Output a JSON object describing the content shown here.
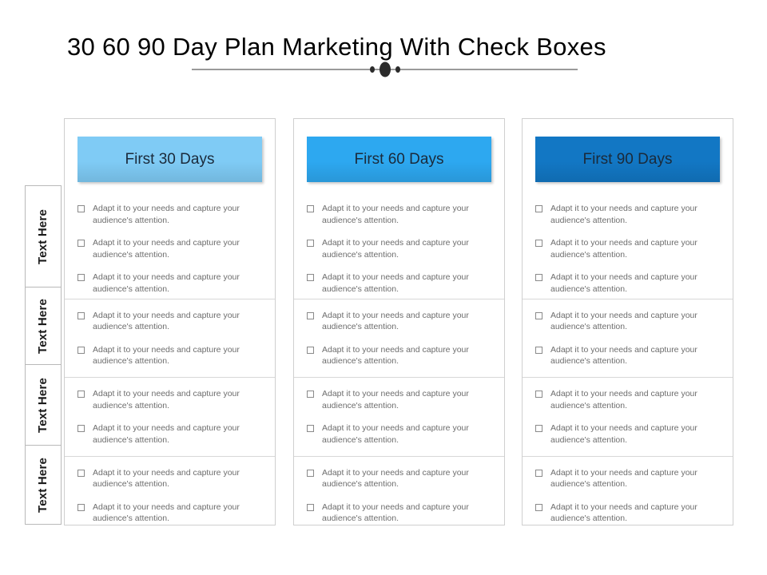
{
  "slide": {
    "title": "30 60 90 Day Plan Marketing  With Check Boxes",
    "divider_icon": "ornament-divider-icon"
  },
  "theme": {
    "header_1_color": "#7fcbf5",
    "header_2_color": "#2da8f0",
    "header_3_color": "#1277c4",
    "header_text_color": "#1b2a3a",
    "body_text_color": "#6d6d6d",
    "border_color": "#cfcfcf",
    "divider_color": "#9a9a9a"
  },
  "row_labels": [
    {
      "label": "Text Here"
    },
    {
      "label": "Text Here"
    },
    {
      "label": "Text Here"
    },
    {
      "label": "Text Here"
    }
  ],
  "bullet_text": "Adapt it to your needs and capture your audience's attention.",
  "columns": [
    {
      "header": "First 30 Days",
      "accent": "#7fcbf5",
      "rows": [
        {
          "bullets": [
            "Adapt it to your needs and capture your audience's attention.",
            "Adapt it to your needs and capture your audience's attention.",
            "Adapt it to your needs and capture your audience's attention."
          ]
        },
        {
          "bullets": [
            "Adapt it to your needs and capture your audience's attention.",
            "Adapt it to your needs and capture your audience's attention."
          ]
        },
        {
          "bullets": [
            "Adapt it to your needs and capture your audience's attention.",
            "Adapt it to your needs and capture your audience's attention."
          ]
        },
        {
          "bullets": [
            "Adapt it to your needs and capture your audience's attention.",
            "Adapt it to your needs and capture your audience's attention."
          ]
        }
      ]
    },
    {
      "header": "First 60 Days",
      "accent": "#2da8f0",
      "rows": [
        {
          "bullets": [
            "Adapt it to your needs and capture your audience's attention.",
            "Adapt it to your needs and capture your audience's attention.",
            "Adapt it to your needs and capture your audience's attention."
          ]
        },
        {
          "bullets": [
            "Adapt it to your needs and capture your audience's attention.",
            "Adapt it to your needs and capture your audience's attention."
          ]
        },
        {
          "bullets": [
            "Adapt it to your needs and capture your audience's attention.",
            "Adapt it to your needs and capture your audience's attention."
          ]
        },
        {
          "bullets": [
            "Adapt it to your needs and capture your audience's attention.",
            "Adapt it to your needs and capture your audience's attention."
          ]
        }
      ]
    },
    {
      "header": "First 90 Days",
      "accent": "#1277c4",
      "rows": [
        {
          "bullets": [
            "Adapt it to your needs and capture your audience's attention.",
            "Adapt it to your needs and capture your audience's attention.",
            "Adapt it to your needs and capture your audience's attention."
          ]
        },
        {
          "bullets": [
            "Adapt it to your needs and capture your audience's attention.",
            "Adapt it to your needs and capture your audience's attention."
          ]
        },
        {
          "bullets": [
            "Adapt it to your needs and capture your audience's attention.",
            "Adapt it to your needs and capture your audience's attention."
          ]
        },
        {
          "bullets": [
            "Adapt it to your needs and capture your audience's attention.",
            "Adapt it to your needs and capture your audience's attention."
          ]
        }
      ]
    }
  ]
}
